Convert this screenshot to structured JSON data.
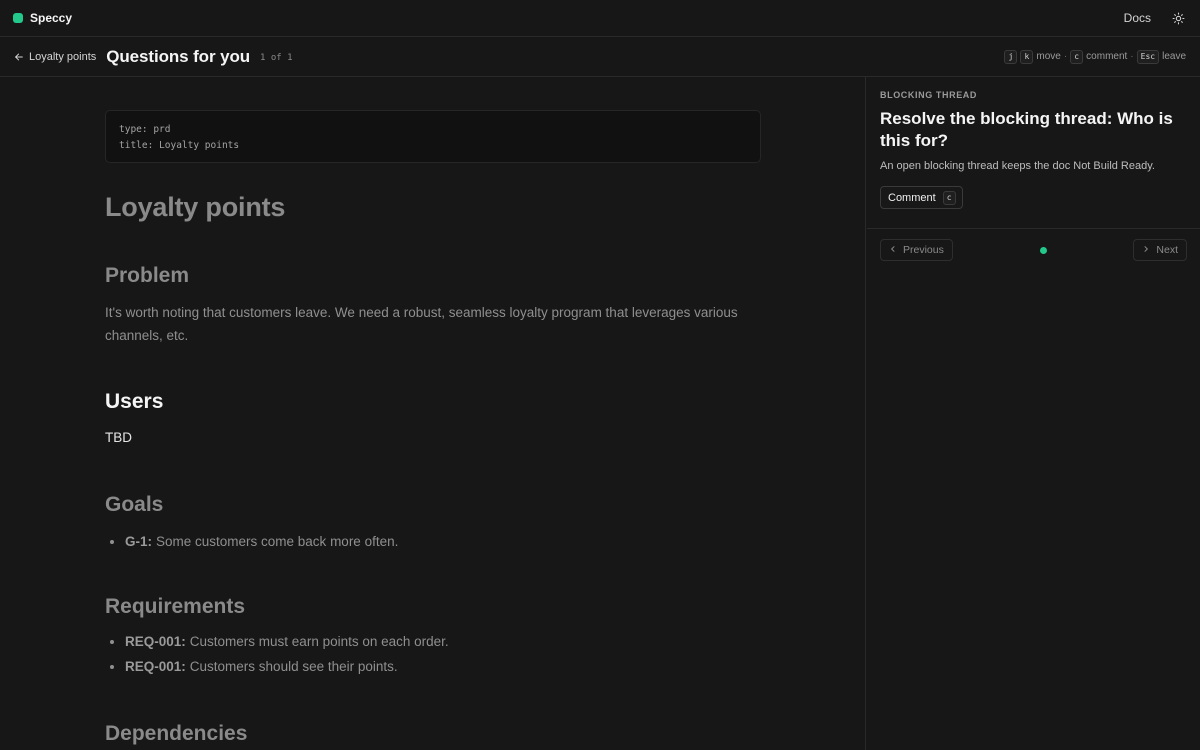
{
  "app": {
    "name": "Speccy",
    "accent": "#22c98a"
  },
  "topbar": {
    "docs_label": "Docs",
    "theme_icon": "sun-icon"
  },
  "subbar": {
    "back_label": "Loyalty points",
    "title": "Questions for you",
    "count": "1 of 1",
    "shortcuts": {
      "k1": "j",
      "k2": "k",
      "move": "move",
      "sep1": "·",
      "k3": "c",
      "comment": "comment",
      "sep2": "·",
      "k4": "Esc",
      "leave": "leave"
    }
  },
  "frontmatter": [
    "type: prd",
    "title: Loyalty points"
  ],
  "doc": {
    "title": "Loyalty points",
    "sections": [
      {
        "heading": "Problem",
        "body": "It's worth noting that customers leave. We need a robust, seamless loyalty program that leverages various channels, etc."
      },
      {
        "heading": "Users",
        "body": "TBD"
      },
      {
        "heading": "Goals",
        "items": [
          {
            "id": "G-1:",
            "text": "Some customers come back more often."
          }
        ]
      },
      {
        "heading": "Requirements",
        "items": [
          {
            "id": "REQ-001:",
            "text": "Customers must earn points on each order."
          },
          {
            "id": "REQ-001:",
            "text": "Customers should see their points."
          }
        ]
      },
      {
        "heading": "Dependencies"
      }
    ]
  },
  "side": {
    "eyebrow": "BLOCKING THREAD",
    "question": "Resolve the blocking thread: Who is this for?",
    "description": "An open blocking thread keeps the doc Not Build Ready.",
    "comment_label": "Comment",
    "comment_key": "c",
    "prev_label": "Previous",
    "next_label": "Next"
  }
}
